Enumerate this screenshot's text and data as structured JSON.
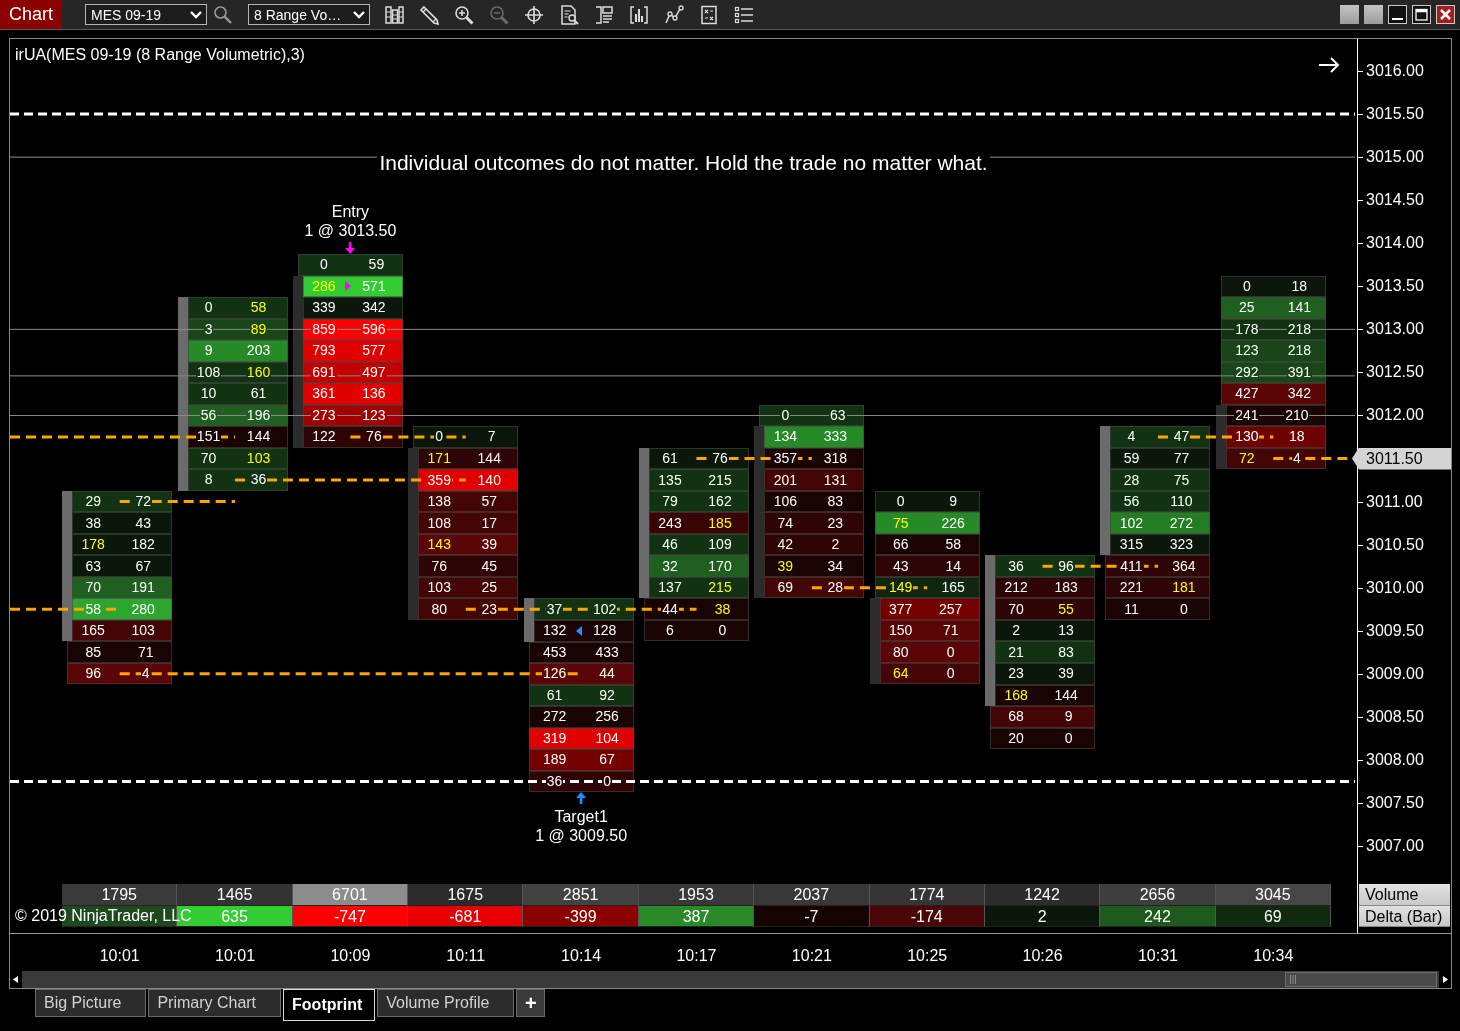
{
  "toolbar": {
    "title": "Chart",
    "instrument": "MES 09-19",
    "bar_type": "8 Range Vo…",
    "tools": [
      {
        "kind": "columns",
        "disabled": false
      },
      {
        "kind": "pencil",
        "disabled": false
      },
      {
        "kind": "zoom-in",
        "disabled": false
      },
      {
        "kind": "zoom-out",
        "disabled": true
      },
      {
        "kind": "crosshair",
        "disabled": false
      },
      {
        "kind": "document-search",
        "disabled": false
      },
      {
        "kind": "layout",
        "disabled": false
      },
      {
        "kind": "bar-chart",
        "disabled": false
      },
      {
        "kind": "line-chart",
        "disabled": false
      },
      {
        "kind": "document",
        "disabled": false
      },
      {
        "kind": "list",
        "disabled": false
      }
    ]
  },
  "chart": {
    "title": "irUA(MES 09-19 (8 Range Volumetric),3)",
    "note": "Individual outcomes do not matter. Hold the trade no matter what.",
    "bars": [
      {
        "kind": "up",
        "rows": [
          {
            "bid": "29",
            "ask": "72",
            "color": "#123312",
            "bid_highlight": false,
            "ask_highlight": false,
            "body": true,
            "order_fill": false
          },
          {
            "bid": "38",
            "ask": "43",
            "color": "#0b170b",
            "bid_highlight": false,
            "ask_highlight": false,
            "body": true,
            "order_fill": false
          },
          {
            "bid": "178",
            "ask": "182",
            "color": "#0b170b",
            "bid_highlight": true,
            "ask_highlight": false,
            "body": true,
            "order_fill": false
          },
          {
            "bid": "63",
            "ask": "67",
            "color": "#0b170b",
            "bid_highlight": false,
            "ask_highlight": false,
            "body": true,
            "order_fill": false
          },
          {
            "bid": "70",
            "ask": "191",
            "color": "#1f5f1f",
            "bid_highlight": false,
            "ask_highlight": false,
            "body": true,
            "order_fill": false
          },
          {
            "bid": "58",
            "ask": "280",
            "color": "#2ea52e",
            "bid_highlight": false,
            "ask_highlight": false,
            "body": true,
            "order_fill": false
          },
          {
            "bid": "165",
            "ask": "103",
            "color": "#440505",
            "bid_highlight": false,
            "ask_highlight": false,
            "body": true,
            "order_fill": false
          },
          {
            "bid": "85",
            "ask": "71",
            "color": "#1a0303",
            "bid_highlight": false,
            "ask_highlight": false,
            "body": false,
            "order_fill": false
          },
          {
            "bid": "96",
            "ask": "4",
            "color": "#5a0606",
            "bid_highlight": false,
            "ask_highlight": false,
            "body": false,
            "order_fill": false
          }
        ]
      },
      {
        "kind": "up",
        "rows": [
          {
            "bid": "0",
            "ask": "58",
            "color": "#123312",
            "bid_highlight": false,
            "ask_highlight": true,
            "body": true,
            "order_fill": false
          },
          {
            "bid": "3",
            "ask": "89",
            "color": "#184618",
            "bid_highlight": false,
            "ask_highlight": true,
            "body": true,
            "order_fill": false
          },
          {
            "bid": "9",
            "ask": "203",
            "color": "#268a26",
            "bid_highlight": false,
            "ask_highlight": false,
            "body": true,
            "order_fill": false
          },
          {
            "bid": "108",
            "ask": "160",
            "color": "#123312",
            "bid_highlight": false,
            "ask_highlight": true,
            "body": true,
            "order_fill": false
          },
          {
            "bid": "10",
            "ask": "61",
            "color": "#123312",
            "bid_highlight": false,
            "ask_highlight": false,
            "body": true,
            "order_fill": false
          },
          {
            "bid": "56",
            "ask": "196",
            "color": "#1f5f1f",
            "bid_highlight": false,
            "ask_highlight": false,
            "body": true,
            "order_fill": false
          },
          {
            "bid": "151",
            "ask": "144",
            "color": "#1a0303",
            "bid_highlight": false,
            "ask_highlight": false,
            "body": true,
            "order_fill": false
          },
          {
            "bid": "70",
            "ask": "103",
            "color": "#123312",
            "bid_highlight": false,
            "ask_highlight": true,
            "body": true,
            "order_fill": false
          },
          {
            "bid": "8",
            "ask": "36",
            "color": "#123312",
            "bid_highlight": false,
            "ask_highlight": false,
            "body": true,
            "order_fill": false
          }
        ]
      },
      {
        "kind": "down",
        "order": {
          "kind": "entry",
          "label": "Entry",
          "detail": "1 @ 3013.50"
        },
        "rows": [
          {
            "bid": "0",
            "ask": "59",
            "color": "#123312",
            "bid_highlight": false,
            "ask_highlight": false,
            "body": false,
            "order_fill": false
          },
          {
            "bid": "286",
            "ask": "571",
            "color": "#33cc33",
            "bid_highlight": true,
            "ask_highlight": false,
            "body": true,
            "order_fill": true
          },
          {
            "bid": "339",
            "ask": "342",
            "color": "#0b170b",
            "bid_highlight": false,
            "ask_highlight": false,
            "body": true,
            "order_fill": false
          },
          {
            "bid": "859",
            "ask": "596",
            "color": "#ff0000",
            "bid_highlight": false,
            "ask_highlight": false,
            "body": true,
            "order_fill": false
          },
          {
            "bid": "793",
            "ask": "577",
            "color": "#e00000",
            "bid_highlight": false,
            "ask_highlight": false,
            "body": true,
            "order_fill": false
          },
          {
            "bid": "691",
            "ask": "497",
            "color": "#c30000",
            "bid_highlight": false,
            "ask_highlight": false,
            "body": true,
            "order_fill": false
          },
          {
            "bid": "361",
            "ask": "136",
            "color": "#e00000",
            "bid_highlight": false,
            "ask_highlight": false,
            "body": true,
            "order_fill": false
          },
          {
            "bid": "273",
            "ask": "123",
            "color": "#a00000",
            "bid_highlight": false,
            "ask_highlight": false,
            "body": true,
            "order_fill": false
          },
          {
            "bid": "122",
            "ask": "76",
            "color": "#2e0404",
            "bid_highlight": false,
            "ask_highlight": false,
            "body": true,
            "order_fill": false
          }
        ]
      },
      {
        "kind": "down",
        "rows": [
          {
            "bid": "0",
            "ask": "7",
            "color": "#0b170b",
            "bid_highlight": false,
            "ask_highlight": false,
            "body": false,
            "order_fill": false
          },
          {
            "bid": "171",
            "ask": "144",
            "color": "#2e0404",
            "bid_highlight": true,
            "ask_highlight": false,
            "body": true,
            "order_fill": false
          },
          {
            "bid": "359",
            "ask": "140",
            "color": "#e00000",
            "bid_highlight": false,
            "ask_highlight": false,
            "body": true,
            "order_fill": false
          },
          {
            "bid": "138",
            "ask": "57",
            "color": "#440505",
            "bid_highlight": false,
            "ask_highlight": false,
            "body": true,
            "order_fill": false
          },
          {
            "bid": "108",
            "ask": "17",
            "color": "#440505",
            "bid_highlight": false,
            "ask_highlight": false,
            "body": true,
            "order_fill": false
          },
          {
            "bid": "143",
            "ask": "39",
            "color": "#5a0606",
            "bid_highlight": true,
            "ask_highlight": false,
            "body": true,
            "order_fill": false
          },
          {
            "bid": "76",
            "ask": "45",
            "color": "#2e0404",
            "bid_highlight": false,
            "ask_highlight": false,
            "body": true,
            "order_fill": false
          },
          {
            "bid": "103",
            "ask": "25",
            "color": "#440505",
            "bid_highlight": false,
            "ask_highlight": false,
            "body": true,
            "order_fill": false
          },
          {
            "bid": "80",
            "ask": "23",
            "color": "#440505",
            "bid_highlight": false,
            "ask_highlight": false,
            "body": true,
            "order_fill": false
          }
        ]
      },
      {
        "kind": "up",
        "order": {
          "kind": "target",
          "label": "Target1",
          "detail": "1 @ 3009.50"
        },
        "rows": [
          {
            "bid": "37",
            "ask": "102",
            "color": "#123312",
            "bid_highlight": false,
            "ask_highlight": false,
            "body": true,
            "order_fill": false
          },
          {
            "bid": "132",
            "ask": "128",
            "color": "#1a0303",
            "bid_highlight": false,
            "ask_highlight": false,
            "body": true,
            "order_fill": true
          },
          {
            "bid": "453",
            "ask": "433",
            "color": "#1a0303",
            "bid_highlight": false,
            "ask_highlight": false,
            "body": false,
            "order_fill": false
          },
          {
            "bid": "126",
            "ask": "44",
            "color": "#5a0606",
            "bid_highlight": false,
            "ask_highlight": false,
            "body": false,
            "order_fill": false
          },
          {
            "bid": "61",
            "ask": "92",
            "color": "#123312",
            "bid_highlight": false,
            "ask_highlight": false,
            "body": false,
            "order_fill": false
          },
          {
            "bid": "272",
            "ask": "256",
            "color": "#1a0303",
            "bid_highlight": false,
            "ask_highlight": false,
            "body": false,
            "order_fill": false
          },
          {
            "bid": "319",
            "ask": "104",
            "color": "#e00000",
            "bid_highlight": false,
            "ask_highlight": false,
            "body": false,
            "order_fill": false
          },
          {
            "bid": "189",
            "ask": "67",
            "color": "#740000",
            "bid_highlight": false,
            "ask_highlight": false,
            "body": false,
            "order_fill": false
          },
          {
            "bid": "36",
            "ask": "0",
            "color": "#2e0404",
            "bid_highlight": false,
            "ask_highlight": false,
            "body": false,
            "order_fill": false
          }
        ]
      },
      {
        "kind": "up",
        "rows": [
          {
            "bid": "61",
            "ask": "76",
            "color": "#0b170b",
            "bid_highlight": false,
            "ask_highlight": false,
            "body": true,
            "order_fill": false
          },
          {
            "bid": "135",
            "ask": "215",
            "color": "#123312",
            "bid_highlight": false,
            "ask_highlight": false,
            "body": true,
            "order_fill": false
          },
          {
            "bid": "79",
            "ask": "162",
            "color": "#123312",
            "bid_highlight": false,
            "ask_highlight": false,
            "body": true,
            "order_fill": false
          },
          {
            "bid": "243",
            "ask": "185",
            "color": "#380404",
            "bid_highlight": false,
            "ask_highlight": true,
            "body": true,
            "order_fill": false
          },
          {
            "bid": "46",
            "ask": "109",
            "color": "#123312",
            "bid_highlight": false,
            "ask_highlight": false,
            "body": true,
            "order_fill": false
          },
          {
            "bid": "32",
            "ask": "170",
            "color": "#1f5f1f",
            "bid_highlight": false,
            "ask_highlight": false,
            "body": true,
            "order_fill": false
          },
          {
            "bid": "137",
            "ask": "215",
            "color": "#123312",
            "bid_highlight": false,
            "ask_highlight": true,
            "body": true,
            "order_fill": false
          },
          {
            "bid": "44",
            "ask": "38",
            "color": "#1a0303",
            "bid_highlight": false,
            "ask_highlight": true,
            "body": false,
            "order_fill": false
          },
          {
            "bid": "6",
            "ask": "0",
            "color": "#1a0303",
            "bid_highlight": false,
            "ask_highlight": false,
            "body": false,
            "order_fill": false
          }
        ]
      },
      {
        "kind": "down",
        "rows": [
          {
            "bid": "0",
            "ask": "63",
            "color": "#123312",
            "bid_highlight": false,
            "ask_highlight": false,
            "body": false,
            "order_fill": false
          },
          {
            "bid": "134",
            "ask": "333",
            "color": "#268a26",
            "bid_highlight": false,
            "ask_highlight": false,
            "body": true,
            "order_fill": false
          },
          {
            "bid": "357",
            "ask": "318",
            "color": "#1a0303",
            "bid_highlight": false,
            "ask_highlight": false,
            "body": true,
            "order_fill": false
          },
          {
            "bid": "201",
            "ask": "131",
            "color": "#440505",
            "bid_highlight": false,
            "ask_highlight": false,
            "body": true,
            "order_fill": false
          },
          {
            "bid": "106",
            "ask": "83",
            "color": "#1a0303",
            "bid_highlight": false,
            "ask_highlight": false,
            "body": true,
            "order_fill": false
          },
          {
            "bid": "74",
            "ask": "23",
            "color": "#2e0404",
            "bid_highlight": false,
            "ask_highlight": false,
            "body": true,
            "order_fill": false
          },
          {
            "bid": "42",
            "ask": "2",
            "color": "#2e0404",
            "bid_highlight": false,
            "ask_highlight": false,
            "body": true,
            "order_fill": false
          },
          {
            "bid": "39",
            "ask": "34",
            "color": "#1a0303",
            "bid_highlight": true,
            "ask_highlight": false,
            "body": true,
            "order_fill": false
          },
          {
            "bid": "69",
            "ask": "28",
            "color": "#440505",
            "bid_highlight": false,
            "ask_highlight": false,
            "body": true,
            "order_fill": false
          }
        ]
      },
      {
        "kind": "down",
        "rows": [
          {
            "bid": "0",
            "ask": "9",
            "color": "#0b170b",
            "bid_highlight": false,
            "ask_highlight": false,
            "body": false,
            "order_fill": false
          },
          {
            "bid": "75",
            "ask": "226",
            "color": "#268a26",
            "bid_highlight": true,
            "ask_highlight": false,
            "body": false,
            "order_fill": false
          },
          {
            "bid": "66",
            "ask": "58",
            "color": "#1a0303",
            "bid_highlight": false,
            "ask_highlight": false,
            "body": false,
            "order_fill": false
          },
          {
            "bid": "43",
            "ask": "14",
            "color": "#2e0404",
            "bid_highlight": false,
            "ask_highlight": false,
            "body": false,
            "order_fill": false
          },
          {
            "bid": "149",
            "ask": "165",
            "color": "#0f260f",
            "bid_highlight": true,
            "ask_highlight": false,
            "body": false,
            "order_fill": false
          },
          {
            "bid": "377",
            "ask": "257",
            "color": "#740000",
            "bid_highlight": false,
            "ask_highlight": false,
            "body": true,
            "order_fill": false
          },
          {
            "bid": "150",
            "ask": "71",
            "color": "#5a0606",
            "bid_highlight": false,
            "ask_highlight": false,
            "body": true,
            "order_fill": false
          },
          {
            "bid": "80",
            "ask": "0",
            "color": "#5a0606",
            "bid_highlight": false,
            "ask_highlight": false,
            "body": true,
            "order_fill": false
          },
          {
            "bid": "64",
            "ask": "0",
            "color": "#440505",
            "bid_highlight": true,
            "ask_highlight": false,
            "body": true,
            "order_fill": false
          }
        ]
      },
      {
        "kind": "up",
        "rows": [
          {
            "bid": "36",
            "ask": "96",
            "color": "#123312",
            "bid_highlight": false,
            "ask_highlight": false,
            "body": true,
            "order_fill": false
          },
          {
            "bid": "212",
            "ask": "183",
            "color": "#2e0404",
            "bid_highlight": false,
            "ask_highlight": false,
            "body": true,
            "order_fill": false
          },
          {
            "bid": "70",
            "ask": "55",
            "color": "#2e0404",
            "bid_highlight": false,
            "ask_highlight": true,
            "body": true,
            "order_fill": false
          },
          {
            "bid": "2",
            "ask": "13",
            "color": "#0b170b",
            "bid_highlight": false,
            "ask_highlight": false,
            "body": true,
            "order_fill": false
          },
          {
            "bid": "21",
            "ask": "83",
            "color": "#123312",
            "bid_highlight": false,
            "ask_highlight": false,
            "body": true,
            "order_fill": false
          },
          {
            "bid": "23",
            "ask": "39",
            "color": "#0b170b",
            "bid_highlight": false,
            "ask_highlight": false,
            "body": true,
            "order_fill": false
          },
          {
            "bid": "168",
            "ask": "144",
            "color": "#1a0303",
            "bid_highlight": true,
            "ask_highlight": false,
            "body": true,
            "order_fill": false
          },
          {
            "bid": "68",
            "ask": "9",
            "color": "#440505",
            "bid_highlight": false,
            "ask_highlight": false,
            "body": false,
            "order_fill": false
          },
          {
            "bid": "20",
            "ask": "0",
            "color": "#1a0303",
            "bid_highlight": false,
            "ask_highlight": false,
            "body": false,
            "order_fill": false
          }
        ]
      },
      {
        "kind": "up",
        "rows": [
          {
            "bid": "4",
            "ask": "47",
            "color": "#123312",
            "bid_highlight": false,
            "ask_highlight": false,
            "body": true,
            "order_fill": false
          },
          {
            "bid": "59",
            "ask": "77",
            "color": "#0b170b",
            "bid_highlight": false,
            "ask_highlight": false,
            "body": true,
            "order_fill": false
          },
          {
            "bid": "28",
            "ask": "75",
            "color": "#123312",
            "bid_highlight": false,
            "ask_highlight": false,
            "body": true,
            "order_fill": false
          },
          {
            "bid": "56",
            "ask": "110",
            "color": "#123312",
            "bid_highlight": false,
            "ask_highlight": false,
            "body": true,
            "order_fill": false
          },
          {
            "bid": "102",
            "ask": "272",
            "color": "#237d23",
            "bid_highlight": false,
            "ask_highlight": false,
            "body": true,
            "order_fill": false
          },
          {
            "bid": "315",
            "ask": "323",
            "color": "#0b170b",
            "bid_highlight": false,
            "ask_highlight": false,
            "body": true,
            "order_fill": false
          },
          {
            "bid": "411",
            "ask": "364",
            "color": "#2e0404",
            "bid_highlight": false,
            "ask_highlight": false,
            "body": false,
            "order_fill": false
          },
          {
            "bid": "221",
            "ask": "181",
            "color": "#2e0404",
            "bid_highlight": false,
            "ask_highlight": true,
            "body": false,
            "order_fill": false
          },
          {
            "bid": "11",
            "ask": "0",
            "color": "#1a0303",
            "bid_highlight": false,
            "ask_highlight": false,
            "body": false,
            "order_fill": false
          }
        ]
      },
      {
        "kind": "down",
        "rows": [
          {
            "bid": "0",
            "ask": "18",
            "color": "#0b170b",
            "bid_highlight": false,
            "ask_highlight": false,
            "body": false,
            "order_fill": false
          },
          {
            "bid": "25",
            "ask": "141",
            "color": "#1f5f1f",
            "bid_highlight": false,
            "ask_highlight": false,
            "body": false,
            "order_fill": false
          },
          {
            "bid": "178",
            "ask": "218",
            "color": "#123312",
            "bid_highlight": false,
            "ask_highlight": false,
            "body": false,
            "order_fill": false
          },
          {
            "bid": "123",
            "ask": "218",
            "color": "#184618",
            "bid_highlight": false,
            "ask_highlight": false,
            "body": false,
            "order_fill": false
          },
          {
            "bid": "292",
            "ask": "391",
            "color": "#184618",
            "bid_highlight": false,
            "ask_highlight": false,
            "body": false,
            "order_fill": false
          },
          {
            "bid": "427",
            "ask": "342",
            "color": "#5a0606",
            "bid_highlight": false,
            "ask_highlight": false,
            "body": false,
            "order_fill": false
          },
          {
            "bid": "241",
            "ask": "210",
            "color": "#1a0303",
            "bid_highlight": false,
            "ask_highlight": false,
            "body": true,
            "order_fill": false
          },
          {
            "bid": "130",
            "ask": "18",
            "color": "#6e0000",
            "bid_highlight": false,
            "ask_highlight": false,
            "body": true,
            "order_fill": false
          },
          {
            "bid": "72",
            "ask": "4",
            "color": "#440505",
            "bid_highlight": true,
            "ask_highlight": false,
            "body": true,
            "order_fill": false
          }
        ]
      }
    ],
    "price_axis": {
      "labels": [
        "3016.00",
        "3015.50",
        "3015.00",
        "3014.50",
        "3014.00",
        "3013.50",
        "3013.00",
        "3012.50",
        "3012.00",
        "3011.00",
        "3010.50",
        "3010.00",
        "3009.50",
        "3009.00",
        "3008.50",
        "3008.00",
        "3007.50",
        "3007.00"
      ],
      "current_price": "3011.50"
    },
    "summary": {
      "row_labels": [
        "Volume",
        "Delta (Bar)"
      ],
      "volume": [
        {
          "value": "1795",
          "color": "#3a3a3a"
        },
        {
          "value": "1465",
          "color": "#333333"
        },
        {
          "value": "6701",
          "color": "#8c8c8c"
        },
        {
          "value": "1675",
          "color": "#2b2b2b"
        },
        {
          "value": "2851",
          "color": "#424242"
        },
        {
          "value": "1953",
          "color": "#383838"
        },
        {
          "value": "2037",
          "color": "#383838"
        },
        {
          "value": "1774",
          "color": "#353535"
        },
        {
          "value": "1242",
          "color": "#2c2c2c"
        },
        {
          "value": "2656",
          "color": "#3e3e3e"
        },
        {
          "value": "3045",
          "color": "#464646"
        }
      ],
      "delta": [
        {
          "color": "#1d4a1d"
        },
        {
          "value": "635",
          "color": "#33cc33"
        },
        {
          "value": "-747",
          "color": "#ff0000"
        },
        {
          "value": "-681",
          "color": "#e60000"
        },
        {
          "value": "-399",
          "color": "#8b0000"
        },
        {
          "value": "387",
          "color": "#2a8a2a"
        },
        {
          "value": "-7",
          "color": "#160303"
        },
        {
          "value": "-174",
          "color": "#4a0606"
        },
        {
          "value": "2",
          "color": "#0b170b"
        },
        {
          "value": "242",
          "color": "#1e5a1e"
        },
        {
          "value": "69",
          "color": "#0f2a0f"
        }
      ]
    },
    "copyright": "© 2019 NinjaTrader, LLC",
    "time_axis": [
      "10:01",
      "10:01",
      "10:09",
      "10:11",
      "10:14",
      "10:17",
      "10:21",
      "10:25",
      "10:26",
      "10:31",
      "10:34"
    ]
  },
  "tabs": [
    {
      "label": "Big Picture",
      "selected": false
    },
    {
      "label": "Primary Chart",
      "selected": false
    },
    {
      "label": "Footprint",
      "selected": true
    },
    {
      "label": "Volume Profile",
      "selected": false
    }
  ],
  "add_tab": "+"
}
